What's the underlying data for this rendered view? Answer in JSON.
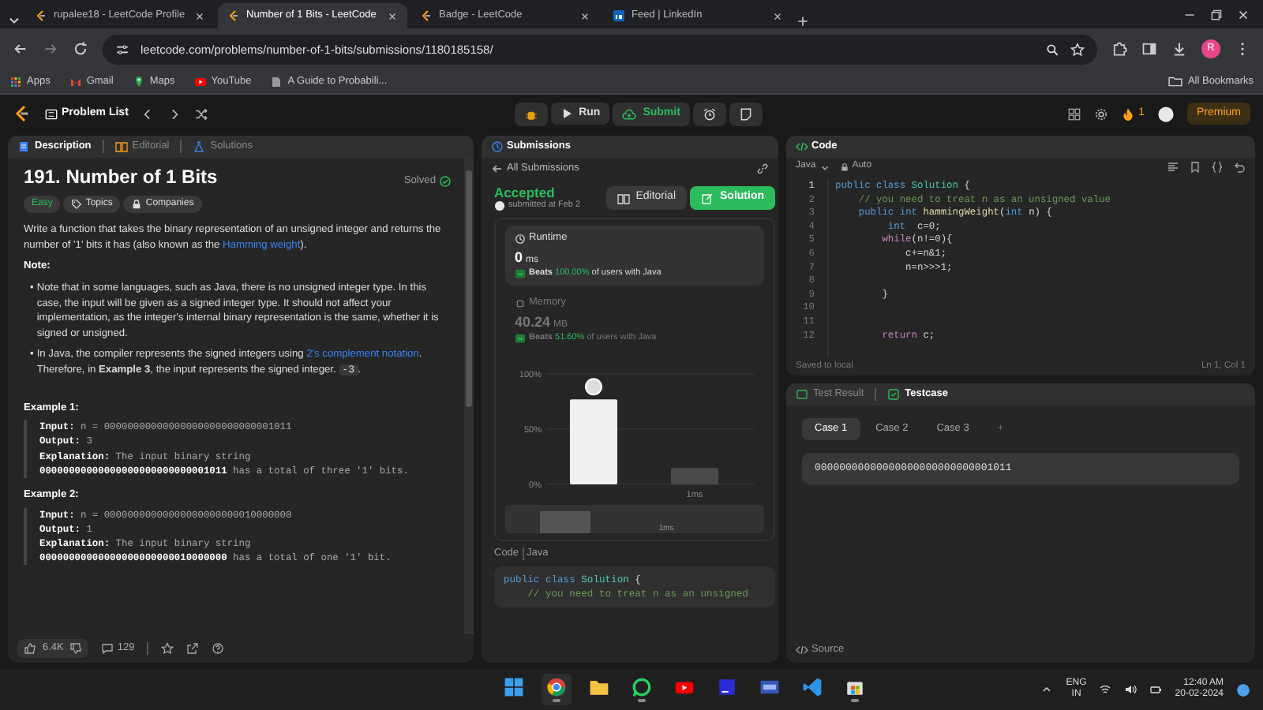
{
  "browser": {
    "tabs": [
      {
        "title": "rupalee18 - LeetCode Profile",
        "selected": false,
        "kind": "leetcode"
      },
      {
        "title": "Number of 1 Bits - LeetCode",
        "selected": true,
        "kind": "leetcode"
      },
      {
        "title": "Badge - LeetCode",
        "selected": false,
        "kind": "leetcode"
      },
      {
        "title": "Feed | LinkedIn",
        "selected": false,
        "kind": "linkedin"
      }
    ],
    "url": "leetcode.com/problems/number-of-1-bits/submissions/1180185158/",
    "profile_initial": "R",
    "bookmarks": [
      {
        "label": "Apps",
        "kind": "apps"
      },
      {
        "label": "Gmail",
        "kind": "mail"
      },
      {
        "label": "Maps",
        "kind": "map"
      },
      {
        "label": "YouTube",
        "kind": "video"
      },
      {
        "label": "A Guide to Probabili...",
        "kind": "page"
      }
    ],
    "all_bookmarks": "All Bookmarks"
  },
  "toolbar": {
    "problem_list": "Problem List",
    "run": "Run",
    "submit": "Submit",
    "streak": "1",
    "premium": "Premium"
  },
  "description_panel": {
    "tabs": [
      {
        "label": "Description",
        "selected": true
      },
      {
        "label": "Editorial",
        "selected": false
      },
      {
        "label": "Solutions",
        "selected": false
      }
    ],
    "title": "191. Number of 1 Bits",
    "status": "Solved",
    "tags": [
      {
        "label": "Easy",
        "kind": "difficulty"
      },
      {
        "label": "Topics",
        "kind": "topics"
      },
      {
        "label": "Companies",
        "kind": "companies"
      }
    ],
    "intro": [
      {
        "kind": "text",
        "text": "Write a function that takes the binary representation of an unsigned integer and returns the number of '1' bits it has (also known as the "
      },
      {
        "kind": "link",
        "text": "Hamming weight"
      },
      {
        "kind": "text",
        "text": ")."
      }
    ],
    "note_heading": "Note:",
    "notes": [
      {
        "bullet": "•",
        "parts": [
          {
            "kind": "text",
            "text": "Note that in some languages, such as Java, there is no unsigned integer type. In this case, the input will be given as a signed integer type. It should not affect your implementation, as the integer's internal binary representation is the same, whether it is signed or unsigned."
          }
        ]
      },
      {
        "bullet": "•",
        "parts": [
          {
            "kind": "text",
            "text": "In Java, the compiler represents the signed integers using "
          },
          {
            "kind": "link",
            "text": "2's complement notation"
          },
          {
            "kind": "text",
            "text": ". Therefore, in **Example 3**, the input represents the signed integer. "
          },
          {
            "kind": "code",
            "text": "-3"
          },
          {
            "kind": "text",
            "text": "."
          }
        ]
      }
    ],
    "examples": [
      {
        "heading": "Example 1:",
        "lines": [
          "**Input:** n = 00000000000000000000000000001011",
          "**Output:** 3",
          "**Explanation:** The input binary string",
          "**00000000000000000000000000001011** has a total of three '1' bits."
        ]
      },
      {
        "heading": "Example 2:",
        "lines": [
          "**Input:** n = 00000000000000000000000010000000",
          "**Output:** 1",
          "**Explanation:** The input binary string",
          "**00000000000000000000000010000000** has a total of one '1' bit."
        ]
      }
    ],
    "likes": "6.4K",
    "comments": "129"
  },
  "submission_panel": {
    "title": "Submissions",
    "back": "All Submissions",
    "verdict": "Accepted",
    "submitted": "submitted at Feb 2",
    "buttons": [
      {
        "label": "Editorial",
        "kind": "plain"
      },
      {
        "label": "Solution",
        "kind": "primary"
      }
    ],
    "stats": [
      {
        "label": "Runtime",
        "kind": "time",
        "value": "0",
        "unit": "ms",
        "beats_label": "Beats",
        "beats_value": "100.00%",
        "beats_suffix": "of users with Java",
        "selected": true
      },
      {
        "label": "Memory",
        "kind": "memory",
        "value": "40.24",
        "unit": "MB",
        "beats_label": "Beats",
        "beats_value": "51.60%",
        "beats_suffix": "of users with Java",
        "selected": false
      }
    ],
    "chart_data": {
      "type": "bar",
      "categories": [
        null,
        "1ms"
      ],
      "values": [
        77,
        15
      ],
      "yticks": [
        {
          "value": 0,
          "label": "0%"
        },
        {
          "value": 50,
          "label": "50%"
        },
        {
          "value": 100,
          "label": "100%"
        }
      ],
      "ylim": [
        0,
        100
      ]
    },
    "brush_label": "1ms",
    "code_label": "Code",
    "code_language": "Java",
    "code_lines": [
      [
        {
          "kind": "kw",
          "text": "public "
        },
        {
          "kind": "kw",
          "text": "class "
        },
        {
          "kind": "ty",
          "text": "Solution"
        },
        {
          "kind": "pl",
          "text": " {"
        }
      ],
      [
        {
          "kind": "cm",
          "text": "    // you need to treat n as an unsigned"
        }
      ]
    ]
  },
  "code_panel": {
    "title": "Code",
    "language": "Java",
    "mode": "Auto",
    "lines": [
      {
        "number": "1",
        "tokens": [
          {
            "kind": "kw",
            "text": "public "
          },
          {
            "kind": "kw",
            "text": "class "
          },
          {
            "kind": "ty",
            "text": "Solution"
          },
          {
            "kind": "pl",
            "text": " {"
          }
        ]
      },
      {
        "number": "2",
        "tokens": [
          {
            "kind": "cm",
            "text": "    // you need to treat n as an unsigned value"
          }
        ]
      },
      {
        "number": "3",
        "tokens": [
          {
            "kind": "kw",
            "text": "    public "
          },
          {
            "kind": "kw",
            "text": "int "
          },
          {
            "kind": "fn",
            "text": "hammingWeight"
          },
          {
            "kind": "pl",
            "text": "("
          },
          {
            "kind": "kw",
            "text": "int "
          },
          {
            "kind": "pl",
            "text": "n) {"
          }
        ]
      },
      {
        "number": "4",
        "tokens": [
          {
            "kind": "kw",
            "text": "         int"
          },
          {
            "kind": "pl",
            "text": "  c=0;"
          }
        ]
      },
      {
        "number": "5",
        "tokens": [
          {
            "kind": "ct",
            "text": "        while"
          },
          {
            "kind": "pl",
            "text": "(n!=0){"
          }
        ]
      },
      {
        "number": "6",
        "tokens": [
          {
            "kind": "pl",
            "text": "            c+=n&1;"
          }
        ]
      },
      {
        "number": "7",
        "tokens": [
          {
            "kind": "pl",
            "text": "            n=n>>>1;"
          }
        ]
      },
      {
        "number": "8"
      },
      {
        "number": "9",
        "tokens": [
          {
            "kind": "pl",
            "text": "        }"
          }
        ]
      },
      {
        "number": "10"
      },
      {
        "number": "11"
      },
      {
        "number": "12",
        "tokens": [
          {
            "kind": "ct",
            "text": "        return"
          },
          {
            "kind": "pl",
            "text": " c;"
          }
        ]
      }
    ],
    "saved": "Saved to local",
    "cursor": "Ln 1, Col 1"
  },
  "test_panel": {
    "tabs": [
      {
        "label": "Test Result",
        "selected": false
      },
      {
        "label": "Testcase",
        "selected": true
      }
    ],
    "cases": [
      {
        "label": "Case 1",
        "selected": true
      },
      {
        "label": "Case 2",
        "selected": false
      },
      {
        "label": "Case 3",
        "selected": false
      }
    ],
    "add": "+",
    "input": "00000000000000000000000000001011",
    "source": "Source"
  },
  "taskbar": {
    "apps": [
      {
        "kind": "start",
        "open": false
      },
      {
        "kind": "browser",
        "open": true
      },
      {
        "kind": "folder",
        "open": false
      },
      {
        "kind": "chat",
        "open": true
      },
      {
        "kind": "video",
        "open": false
      },
      {
        "kind": "ide",
        "open": false
      },
      {
        "kind": "app",
        "open": false
      },
      {
        "kind": "editor",
        "open": false
      },
      {
        "kind": "store",
        "open": true
      }
    ],
    "lang": "ENG",
    "region": "IN",
    "time": "12:40 AM",
    "date": "20-02-2024"
  }
}
